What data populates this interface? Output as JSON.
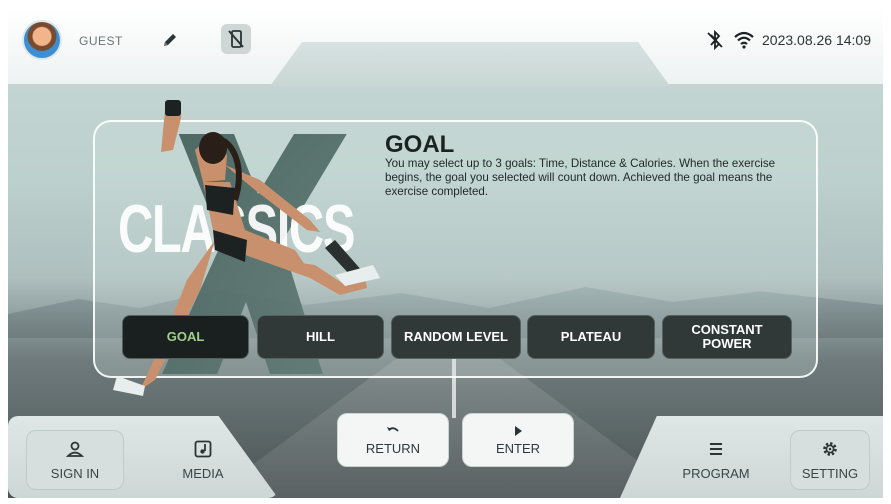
{
  "status_bar": {
    "user_name": "GUEST",
    "datetime": "2023.08.26 14:09",
    "icons": [
      "user-avatar",
      "pencil-icon",
      "no-phone-icon",
      "bluetooth-off-icon",
      "wifi-icon"
    ]
  },
  "hero": {
    "brand_text": "CLASSICS"
  },
  "goal_panel": {
    "title": "GOAL",
    "description": "You may select up to 3 goals: Time, Distance & Calories. When the exercise begins, the goal you selected will count down. Achieved the goal means the exercise completed."
  },
  "program_tabs": [
    {
      "label": "GOAL",
      "selected": true
    },
    {
      "label": "HILL",
      "selected": false
    },
    {
      "label": "RANDOM LEVEL",
      "selected": false
    },
    {
      "label": "PLATEAU",
      "selected": false
    },
    {
      "label": "CONSTANT POWER",
      "selected": false
    }
  ],
  "bottom_bar": {
    "sign_in": "SIGN IN",
    "media": "MEDIA",
    "return": "RETURN",
    "enter": "ENTER",
    "program": "PROGRAM",
    "setting": "SETTING"
  },
  "colors": {
    "accent_selected_text": "#9fd08b",
    "tab_bg": "#303838",
    "text_dark": "#1b2222"
  }
}
